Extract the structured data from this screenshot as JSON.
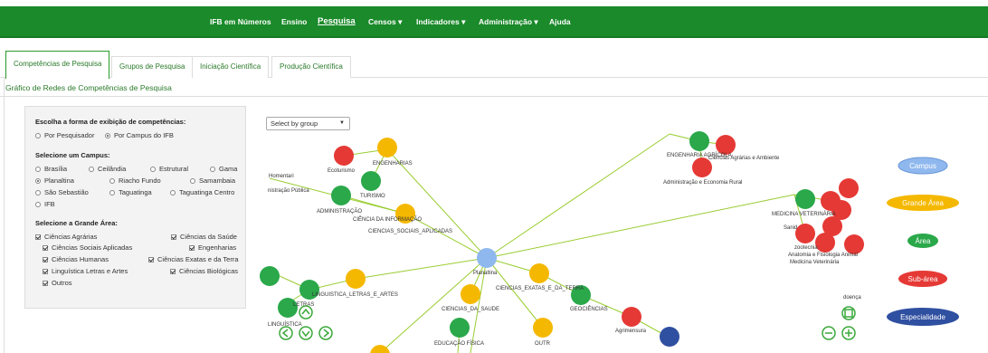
{
  "nav": {
    "items": [
      "IFB em Números",
      "Ensino",
      "Pesquisa",
      "Censos ▾",
      "Indicadores ▾",
      "Administração ▾",
      "Ajuda"
    ],
    "active": "Pesquisa"
  },
  "tabs": [
    "Competências de Pesquisa",
    "Grupos de Pesquisa",
    "Iniciação Científica",
    "Produção Científica"
  ],
  "section_title": "Gráfico de Redes de Competências de Pesquisa",
  "panel": {
    "display_title": "Escolha a forma de exibição de competências:",
    "display_options": [
      {
        "label": "Por Pesquisador",
        "checked": false
      },
      {
        "label": "Por Campus do IFB",
        "checked": true
      }
    ],
    "campus_title": "Selecione um Campus:",
    "campus_options": [
      {
        "label": "Brasília",
        "checked": false
      },
      {
        "label": "Ceilândia",
        "checked": false
      },
      {
        "label": "Estrutural",
        "checked": false
      },
      {
        "label": "Gama",
        "checked": false
      },
      {
        "label": "Planaltina",
        "checked": true
      },
      {
        "label": "Riacho Fundo",
        "checked": false
      },
      {
        "label": "Samambaia",
        "checked": false
      },
      {
        "label": "São Sebastião",
        "checked": false
      },
      {
        "label": "Taguatinga",
        "checked": false
      },
      {
        "label": "Taguatinga Centro",
        "checked": false
      },
      {
        "label": "IFB",
        "checked": false
      }
    ],
    "area_title": "Selecione a Grande Área:",
    "area_options": [
      {
        "label": "Ciências Agrárias",
        "checked": true
      },
      {
        "label": "Ciências da Saúde",
        "checked": true
      },
      {
        "label": "Ciências Sociais Aplicadas",
        "checked": true
      },
      {
        "label": "Engenharias",
        "checked": true
      },
      {
        "label": "Ciências Humanas",
        "checked": true
      },
      {
        "label": "Ciências Exatas e da Terra",
        "checked": true
      },
      {
        "label": "Linguística Letras e Artes",
        "checked": true
      },
      {
        "label": "Ciências Biológicas",
        "checked": true
      },
      {
        "label": "Outros",
        "checked": true
      }
    ]
  },
  "select": {
    "value": "Select by group"
  },
  "graph_labels": {
    "center": "Planaltina",
    "nodes": [
      "ENGENHARIAS",
      "Ecoturismo",
      "TURISMO",
      "ADMINISTRAÇÃO",
      "CIÊNCIA DA INFORMAÇÃO",
      "CIENCIAS_SOCIAIS_APLICADAS",
      "nistração Pública",
      "Homentari",
      "LINGUISTICA_LETRAS_E_ARTES",
      "CIENCIAS_DA_SAUDE",
      "CIENCIAS_EXATAS_E_DA_TERRA",
      "GEOCIÊNCIAS",
      "Agrimensura",
      "EDUCAÇÃO FÍSICA",
      "OUTR",
      "ENGENHARIA AGRÍCOLA",
      "Ciências Agrárias e Ambiente",
      "Administração e Economia Rural",
      "MEDICINA VETERINÁRIA",
      "zootecnia",
      "Anatomia e Fisiologia Animal",
      "Medicina Veterinária",
      "doença",
      "LINGUÍSTICA",
      "LETRAS",
      "Sanid"
    ]
  },
  "legend": [
    "Campus",
    "Grande Área",
    "Área",
    "Sub-área",
    "Especialidade"
  ],
  "colors": {
    "nav_green": "#1a8a2a",
    "campus": "#8fb8ee",
    "grande_area": "#f5b800",
    "area": "#2aa84a",
    "sub_area": "#e53935",
    "especialidade": "#2f4fa0",
    "edge": "#9acd32"
  },
  "controls": [
    "zoom-out-icon",
    "zoom-in-icon",
    "fit-icon",
    "pan-left-icon",
    "pan-down-icon",
    "pan-right-icon",
    "pan-up-icon"
  ]
}
